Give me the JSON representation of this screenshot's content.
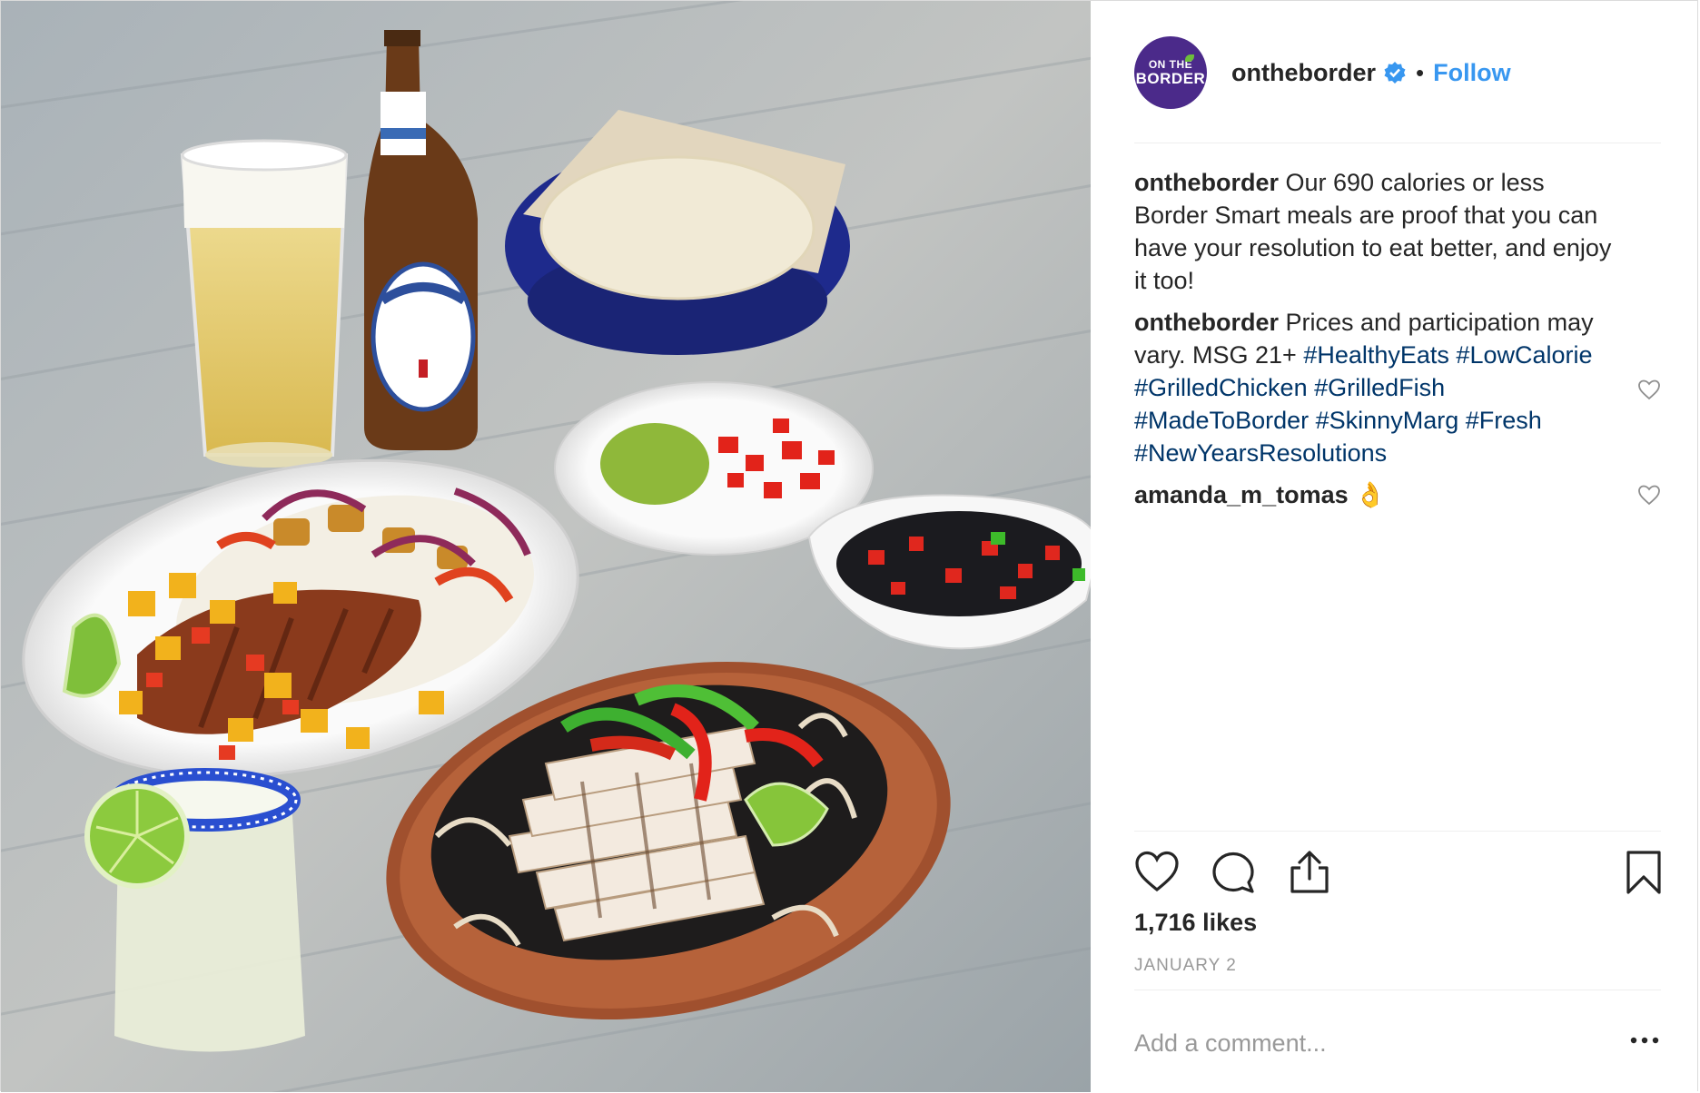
{
  "post": {
    "image_alt": "Border Smart meals: grilled fish with mango salsa, chicken fajitas on skillet, tortillas, guacamole and pico, black beans, beer and margarita"
  },
  "header": {
    "avatar_line1": "ON THE",
    "avatar_line2": "BORDER",
    "username": "ontheborder",
    "separator": "•",
    "follow_label": "Follow"
  },
  "comments": [
    {
      "user": "ontheborder",
      "text": " Our 690 calories or less Border Smart meals are proof that you can have your resolution to eat better, and enjoy it too!"
    },
    {
      "user": "ontheborder",
      "text": " Prices and participation may vary. MSG 21+ ",
      "tags": [
        "#HealthyEats",
        "#LowCalorie",
        "#GrilledChicken",
        "#GrilledFish",
        "#MadeToBorder",
        "#SkinnyMarg",
        "#Fresh",
        "#NewYearsResolutions"
      ]
    },
    {
      "user": "amanda_m_tomas",
      "text": " 👌"
    }
  ],
  "actions": {
    "like_icon": "heart-icon",
    "comment_icon": "comment-icon",
    "share_icon": "share-icon",
    "save_icon": "bookmark-icon"
  },
  "likes": "1,716 likes",
  "date": "JANUARY 2",
  "add_comment": {
    "placeholder": "Add a comment...",
    "more_icon": "ellipsis-icon"
  },
  "colors": {
    "link_blue": "#3897f0",
    "hashtag_blue": "#003569",
    "avatar_purple": "#4b2a8a",
    "muted_gray": "#999999"
  }
}
